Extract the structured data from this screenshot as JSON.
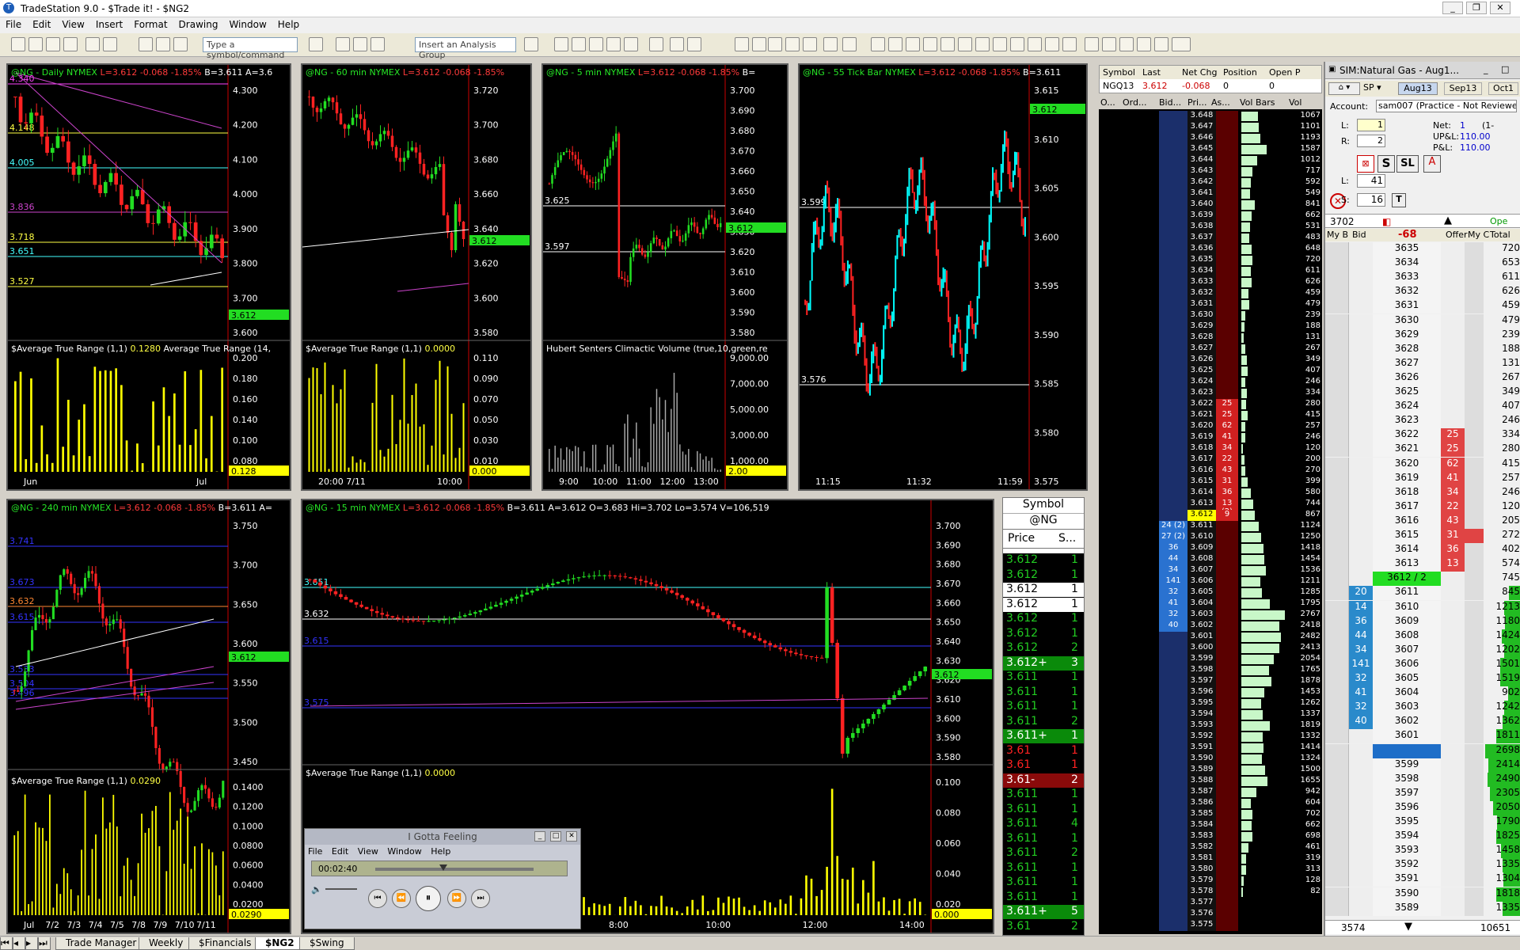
{
  "app": {
    "title": "TradeStation 9.0 - $Trade it! - $NG2"
  },
  "menu": [
    "File",
    "Edit",
    "View",
    "Insert",
    "Format",
    "Drawing",
    "Window",
    "Help"
  ],
  "toolbar": {
    "symbol_placeholder": "Type a symbol/command",
    "analysis_group": "Insert an Analysis Group"
  },
  "charts": {
    "daily": {
      "sym": "@NG - Daily NYMEX",
      "last": "L=3.612",
      "chg": "-0.068",
      "pct": "-1.85%",
      "bidask": "B=3.611 A=3.6",
      "ind": "$Average True Range (1,1)",
      "ind_val": "0.1280",
      "ind2": "Average True Range (14,",
      "price_axis": [
        "4.300",
        "4.200",
        "4.100",
        "4.000",
        "3.900",
        "3.800",
        "3.700",
        "3.600"
      ],
      "ind_axis": [
        "0.200",
        "0.180",
        "0.160",
        "0.140",
        "0.100",
        "0.080"
      ],
      "ind_tag": "0.128",
      "price_tag": "3.612",
      "time_axis": [
        "Jun",
        "Jul"
      ],
      "levels": [
        "4.340",
        "4.148",
        "4.005",
        "3.836",
        "3.718",
        "3.651",
        "3.527"
      ]
    },
    "m60": {
      "sym": "@NG - 60 min NYMEX",
      "last": "L=3.612",
      "chg": "-0.068",
      "pct": "-1.85%",
      "ind": "$Average True Range (1,1)",
      "ind_val": "0.0000",
      "price_axis": [
        "3.720",
        "3.700",
        "3.680",
        "3.660",
        "3.640",
        "3.620",
        "3.600",
        "3.580"
      ],
      "ind_axis": [
        "0.110",
        "0.090",
        "0.070",
        "0.050",
        "0.030",
        "0.010"
      ],
      "ind_tag": "0.000",
      "price_tag": "3.612",
      "time_axis": [
        "20:00 7/11",
        "10:00"
      ]
    },
    "m5": {
      "sym": "@NG - 5 min NYMEX",
      "last": "L=3.612",
      "chg": "-0.068",
      "pct": "-1.85%",
      "extra": "B=",
      "ind": "Hubert Senters Climactic Volume (true,10,green,re",
      "price_axis": [
        "3.700",
        "3.690",
        "3.680",
        "3.670",
        "3.660",
        "3.650",
        "3.640",
        "3.630",
        "3.620",
        "3.610",
        "3.600",
        "3.590",
        "3.580"
      ],
      "ind_axis": [
        "9,000.00",
        "7,000.00",
        "5,000.00",
        "3,000.00",
        "1,000.00"
      ],
      "ind_tag": "2.00",
      "price_tag": "3.612",
      "time_axis": [
        "9:00",
        "10:00",
        "11:00",
        "12:00",
        "13:00"
      ],
      "levels": [
        "3.625",
        "3.597"
      ]
    },
    "tick": {
      "sym": "@NG - 55 Tick Bar NYMEX",
      "last": "L=3.612",
      "chg": "-0.068",
      "pct": "-1.85%",
      "bidask": "B=3.611",
      "price_axis": [
        "3.615",
        "3.610",
        "3.605",
        "3.600",
        "3.595",
        "3.590",
        "3.585",
        "3.580",
        "3.575"
      ],
      "price_tag": "3.612",
      "time_axis": [
        "11:15",
        "11:32",
        "11:59"
      ],
      "levels": [
        "3.599",
        "3.576"
      ]
    },
    "m240": {
      "sym": "@NG - 240 min NYMEX",
      "last": "L=3.612",
      "chg": "-0.068",
      "pct": "-1.85%",
      "bidask": "B=3.611 A=",
      "ind": "$Average True Range (1,1)",
      "ind_val": "0.0290",
      "price_axis": [
        "3.750",
        "3.700",
        "3.650",
        "3.600",
        "3.550",
        "3.500",
        "3.450"
      ],
      "ind_axis": [
        "0.1400",
        "0.1200",
        "0.1000",
        "0.0800",
        "0.0600",
        "0.0400",
        "0.0200"
      ],
      "ind_tag": "0.0290",
      "price_tag": "3.612",
      "time_axis": [
        "Jul",
        "7/2",
        "7/3",
        "7/4",
        "7/5",
        "7/8",
        "7/9",
        "7/10",
        "7/11"
      ],
      "levels": [
        "3.741",
        "3.673",
        "3.632",
        "3.615",
        "3.533",
        "3.504",
        "3.496"
      ]
    },
    "m15": {
      "sym": "@NG - 15 min NYMEX",
      "last": "L=3.612",
      "chg": "-0.068",
      "pct": "-1.85%",
      "quote": "B=3.611 A=3.612 O=3.683 Hi=3.702 Lo=3.574 V=106,519",
      "ind": "$Average True Range (1,1)",
      "ind_val": "0.0000",
      "price_axis": [
        "3.700",
        "3.690",
        "3.680",
        "3.670",
        "3.660",
        "3.650",
        "3.640",
        "3.630",
        "3.620",
        "3.610",
        "3.600",
        "3.590",
        "3.580"
      ],
      "ind_axis": [
        "0.100",
        "0.080",
        "0.060",
        "0.040",
        "0.020"
      ],
      "ind_tag": "0.000",
      "price_tag": "3.612",
      "time_axis": [
        "2:00",
        "4:00",
        "6:00",
        "8:00",
        "10:00",
        "12:00",
        "14:00"
      ],
      "levels": [
        "3.651",
        "3.632",
        "3.615",
        "3.575"
      ]
    }
  },
  "time_sales": {
    "header": "Symbol",
    "symbol": "@NG",
    "col_price": "Price",
    "col_size": "S...",
    "rows": [
      [
        "3.612",
        "1",
        "g"
      ],
      [
        "3.612",
        "1",
        "g"
      ],
      [
        "3.612",
        "1",
        "w"
      ],
      [
        "3.612",
        "1",
        "w"
      ],
      [
        "3.612",
        "1",
        "g"
      ],
      [
        "3.612",
        "1",
        "g"
      ],
      [
        "3.612",
        "2",
        "g"
      ],
      [
        "3.612+",
        "3",
        "G"
      ],
      [
        "3.611",
        "1",
        "g"
      ],
      [
        "3.611",
        "1",
        "g"
      ],
      [
        "3.611",
        "1",
        "g"
      ],
      [
        "3.611",
        "2",
        "g"
      ],
      [
        "3.611+",
        "1",
        "G"
      ],
      [
        "3.61",
        "1",
        "r"
      ],
      [
        "3.61",
        "1",
        "r"
      ],
      [
        "3.61-",
        "2",
        "R"
      ],
      [
        "3.611",
        "1",
        "g"
      ],
      [
        "3.611",
        "1",
        "g"
      ],
      [
        "3.611",
        "4",
        "g"
      ],
      [
        "3.611",
        "1",
        "g"
      ],
      [
        "3.611",
        "2",
        "g"
      ],
      [
        "3.611",
        "1",
        "g"
      ],
      [
        "3.611",
        "1",
        "g"
      ],
      [
        "3.611",
        "1",
        "g"
      ],
      [
        "3.611+",
        "5",
        "G"
      ],
      [
        "3.61",
        "2",
        "g"
      ]
    ]
  },
  "matrix": {
    "headers": [
      "Symbol",
      "Last",
      "Net Chg",
      "Position",
      "Open P"
    ],
    "row": [
      "NGQ13",
      "3.612",
      "-0.068",
      "0",
      "0"
    ],
    "sub_headers": [
      "O...",
      "Ord...",
      "Bid...",
      "Pri...",
      "As...",
      "Vol Bars",
      "Vol"
    ],
    "prices": [
      "3.648",
      "3.647",
      "3.646",
      "3.645",
      "3.644",
      "3.643",
      "3.642",
      "3.641",
      "3.640",
      "3.639",
      "3.638",
      "3.637",
      "3.636",
      "3.635",
      "3.634",
      "3.633",
      "3.632",
      "3.631",
      "3.630",
      "3.629",
      "3.628",
      "3.627",
      "3.626",
      "3.625",
      "3.624",
      "3.623",
      "3.622",
      "3.621",
      "3.620",
      "3.619",
      "3.618",
      "3.617",
      "3.616",
      "3.615",
      "3.614",
      "3.613",
      "3.612",
      "3.611",
      "3.610",
      "3.609",
      "3.608",
      "3.607",
      "3.606",
      "3.605",
      "3.604",
      "3.603",
      "3.602",
      "3.601",
      "3.600",
      "3.599",
      "3.598",
      "3.597",
      "3.596",
      "3.595",
      "3.594",
      "3.593",
      "3.592",
      "3.591",
      "3.590",
      "3.589",
      "3.588",
      "3.587",
      "3.586",
      "3.585",
      "3.584",
      "3.583",
      "3.582",
      "3.581",
      "3.580",
      "3.579",
      "3.578",
      "3.577",
      "3.576",
      "3.575"
    ],
    "vols": [
      "1067",
      "1101",
      "1193",
      "1587",
      "1012",
      "717",
      "592",
      "549",
      "841",
      "662",
      "531",
      "483",
      "648",
      "720",
      "611",
      "626",
      "459",
      "479",
      "239",
      "188",
      "131",
      "267",
      "349",
      "407",
      "246",
      "334",
      "280",
      "415",
      "257",
      "246",
      "120",
      "200",
      "270",
      "399",
      "580",
      "744",
      "867",
      "1124",
      "1250",
      "1418",
      "1454",
      "1536",
      "1211",
      "1285",
      "1795",
      "2767",
      "2418",
      "2482",
      "2413",
      "2054",
      "1765",
      "1878",
      "1453",
      "1262",
      "1337",
      "1819",
      "1332",
      "1414",
      "1324",
      "1500",
      "1655",
      "942",
      "604",
      "702",
      "662",
      "698",
      "461",
      "319",
      "313",
      "128",
      "82",
      "",
      "",
      ""
    ],
    "asks": {
      "3.622": "25",
      "3.621": "25",
      "3.620": "62",
      "3.619": "41",
      "3.618": "34",
      "3.617": "22",
      "3.616": "43",
      "3.615": "31",
      "3.614": "36",
      "3.613": "13 (2)",
      "3.612": "9"
    },
    "bids": {
      "3.611": "24 (2)",
      "3.610": "27 (2)",
      "3.609": "36",
      "3.608": "44",
      "3.607": "34",
      "3.606": "141",
      "3.605": "32",
      "3.604": "41",
      "3.603": "32",
      "3.602": "40"
    }
  },
  "dom": {
    "title": "SIM:Natural Gas - Aug1...",
    "tabs": [
      "Aug13",
      "Sep13",
      "Oct1"
    ],
    "account_label": "Account:",
    "account": "sam007 (Practice - Not Reviewed)",
    "l_label": "L:",
    "l_val": "1",
    "r_label": "R:",
    "r_val": "2",
    "net_label": "Net:",
    "net_val": "1",
    "net_extra": "(1-",
    "upl_label": "UP&L:",
    "upl_val": "110.00",
    "pl_label": "P&L:",
    "pl_val": "110.00",
    "qty_l": "41",
    "qty_s": "16",
    "qty_l_label": "L:",
    "qty_s_label": "S:",
    "last_vol": "3702",
    "chg": "-68",
    "open_label": "Ope",
    "col_heads": [
      "My B",
      "Bid",
      "",
      "Offer",
      "My C",
      "Total"
    ],
    "bottom_left": "3574",
    "bottom_right": "10651",
    "rows": [
      [
        "3635",
        "",
        "",
        "720"
      ],
      [
        "3634",
        "",
        "",
        "653"
      ],
      [
        "3633",
        "",
        "",
        "611"
      ],
      [
        "3632",
        "",
        "",
        "626"
      ],
      [
        "3631",
        "",
        "",
        "459"
      ],
      [
        "3630",
        "",
        "",
        "479"
      ],
      [
        "3629",
        "",
        "",
        "239"
      ],
      [
        "3628",
        "",
        "",
        "188"
      ],
      [
        "3627",
        "",
        "",
        "131"
      ],
      [
        "3626",
        "",
        "",
        "267"
      ],
      [
        "3625",
        "",
        "",
        "349"
      ],
      [
        "3624",
        "",
        "",
        "407"
      ],
      [
        "3623",
        "",
        "",
        "246"
      ],
      [
        "3622",
        "",
        "25",
        "334"
      ],
      [
        "3621",
        "",
        "25",
        "280"
      ],
      [
        "3620",
        "",
        "62",
        "415"
      ],
      [
        "3619",
        "",
        "41",
        "257"
      ],
      [
        "3618",
        "",
        "34",
        "246"
      ],
      [
        "3617",
        "",
        "22",
        "120"
      ],
      [
        "3616",
        "",
        "43",
        "205"
      ],
      [
        "3615",
        "",
        "31",
        "272"
      ],
      [
        "3614",
        "",
        "36",
        "402"
      ],
      [
        "3613",
        "",
        "13",
        "574"
      ],
      [
        "3612 / 2",
        "",
        "",
        "745"
      ],
      [
        "3611",
        "20",
        "",
        "845"
      ],
      [
        "3610",
        "14",
        "",
        "1213"
      ],
      [
        "3609",
        "36",
        "",
        "1180"
      ],
      [
        "3608",
        "44",
        "",
        "1424"
      ],
      [
        "3607",
        "34",
        "",
        "1202"
      ],
      [
        "3606",
        "141",
        "",
        "1501"
      ],
      [
        "3605",
        "32",
        "",
        "1519"
      ],
      [
        "3604",
        "41",
        "",
        "902"
      ],
      [
        "3603",
        "32",
        "",
        "1242"
      ],
      [
        "3602",
        "40",
        "",
        "1362"
      ],
      [
        "3601",
        "",
        "",
        "1811"
      ],
      [
        "3600",
        "",
        "",
        "2698"
      ],
      [
        "3599",
        "",
        "",
        "2414"
      ],
      [
        "3598",
        "",
        "",
        "2490"
      ],
      [
        "3597",
        "",
        "",
        "2305"
      ],
      [
        "3596",
        "",
        "",
        "2050"
      ],
      [
        "3595",
        "",
        "",
        "1790"
      ],
      [
        "3594",
        "",
        "",
        "1825"
      ],
      [
        "3593",
        "",
        "",
        "1458"
      ],
      [
        "3592",
        "",
        "",
        "1335"
      ],
      [
        "3591",
        "",
        "",
        "1304"
      ],
      [
        "3590",
        "",
        "",
        "1818"
      ],
      [
        "3589",
        "",
        "",
        "1335"
      ]
    ]
  },
  "media": {
    "title": "I Gotta Feeling",
    "menu": [
      "File",
      "Edit",
      "View",
      "Window",
      "Help"
    ],
    "time": "00:02:40",
    "progress": 0.43
  },
  "tabs": [
    "Trade Manager",
    "Weekly",
    "$Financials",
    "$NG2",
    "$Swing"
  ],
  "colors": {
    "up": "#22dd22",
    "down": "#ff2222",
    "cyan": "#00ffff",
    "volume": "#ffff00",
    "bid": "#2a72d0",
    "ask": "#d02020",
    "volbar": "#c8f7c8"
  }
}
